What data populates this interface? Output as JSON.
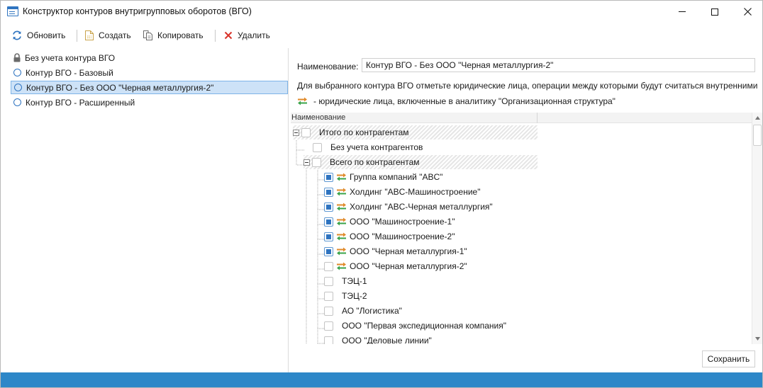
{
  "window": {
    "title": "Конструктор контуров внутригрупповых оборотов (ВГО)"
  },
  "toolbar": {
    "refresh_label": "Обновить",
    "create_label": "Создать",
    "copy_label": "Копировать",
    "delete_label": "Удалить"
  },
  "contours": [
    {
      "label": "Без учета контура ВГО",
      "icon": "lock-icon",
      "selected": false
    },
    {
      "label": "Контур ВГО - Базовый",
      "icon": "radio-icon",
      "selected": false
    },
    {
      "label": "Контур ВГО - Без ООО \"Черная металлургия-2\"",
      "icon": "radio-icon",
      "selected": true
    },
    {
      "label": "Контур ВГО - Расширенный",
      "icon": "radio-icon",
      "selected": false
    }
  ],
  "details": {
    "name_label": "Наименование:",
    "name_value": "Контур ВГО - Без ООО \"Черная металлургия-2\"",
    "hint": "Для выбранного контура ВГО отметьте юридические лица, операции между которыми будут считаться внутренними",
    "legend": "- юридические лица, включенные в аналитику \"Организационная структура\"",
    "save_label": "Сохранить"
  },
  "tree": {
    "column_header": "Наименование",
    "rows": [
      {
        "label": "Итого по контрагентам",
        "level": 0,
        "expandable": true,
        "checked": false,
        "org_icon": false,
        "group": true
      },
      {
        "label": "Без учета контрагентов",
        "level": 1,
        "expandable": false,
        "checked": false,
        "org_icon": false,
        "group": false
      },
      {
        "label": "Всего по контрагентам",
        "level": 1,
        "expandable": true,
        "checked": false,
        "org_icon": false,
        "group": true
      },
      {
        "label": "Группа компаний \"ABC\"",
        "level": 2,
        "expandable": false,
        "checked": true,
        "org_icon": true,
        "group": false
      },
      {
        "label": "Холдинг \"ABC-Машиностроение\"",
        "level": 2,
        "expandable": false,
        "checked": true,
        "org_icon": true,
        "group": false
      },
      {
        "label": "Холдинг \"ABC-Черная металлургия\"",
        "level": 2,
        "expandable": false,
        "checked": true,
        "org_icon": true,
        "group": false
      },
      {
        "label": "ООО \"Машиностроение-1\"",
        "level": 2,
        "expandable": false,
        "checked": true,
        "org_icon": true,
        "group": false
      },
      {
        "label": "ООО \"Машиностроение-2\"",
        "level": 2,
        "expandable": false,
        "checked": true,
        "org_icon": true,
        "group": false
      },
      {
        "label": "ООО \"Черная металлургия-1\"",
        "level": 2,
        "expandable": false,
        "checked": true,
        "org_icon": true,
        "group": false
      },
      {
        "label": "ООО \"Черная металлургия-2\"",
        "level": 2,
        "expandable": false,
        "checked": false,
        "org_icon": true,
        "group": false
      },
      {
        "label": "ТЭЦ-1",
        "level": 2,
        "expandable": false,
        "checked": false,
        "org_icon": false,
        "group": false
      },
      {
        "label": "ТЭЦ-2",
        "level": 2,
        "expandable": false,
        "checked": false,
        "org_icon": false,
        "group": false
      },
      {
        "label": "АО \"Логистика\"",
        "level": 2,
        "expandable": false,
        "checked": false,
        "org_icon": false,
        "group": false
      },
      {
        "label": "ООО \"Первая экспедиционная компания\"",
        "level": 2,
        "expandable": false,
        "checked": false,
        "org_icon": false,
        "group": false
      },
      {
        "label": "ООО \"Деловые линии\"",
        "level": 2,
        "expandable": false,
        "checked": false,
        "org_icon": false,
        "group": false
      }
    ]
  },
  "colors": {
    "accent": "#2f74c0",
    "selection": "#cde2f7",
    "status_bar": "#2d87c8",
    "delete_red": "#d9332b"
  }
}
